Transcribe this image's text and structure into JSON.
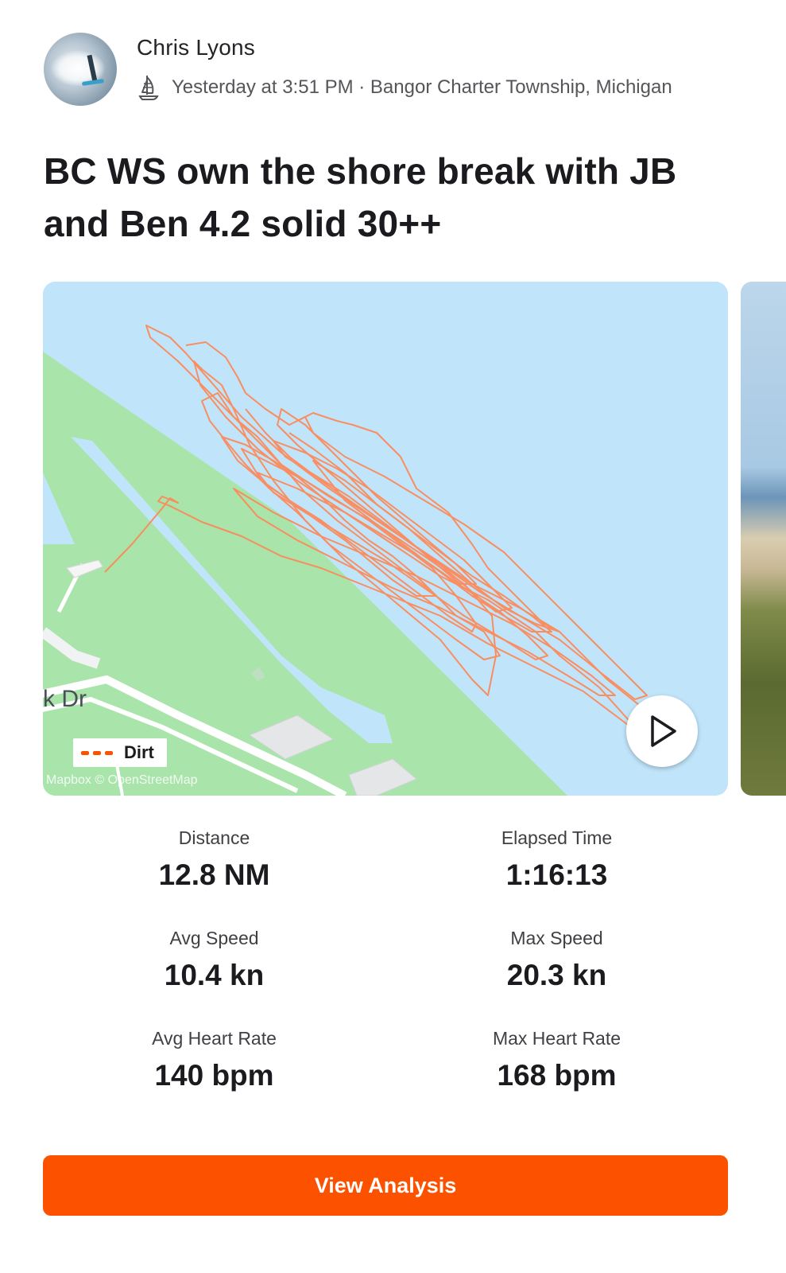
{
  "post": {
    "athlete_name": "Chris Lyons",
    "sport_icon": "windsurf-icon",
    "meta_text": "Yesterday at 3:51 PM · Bangor Charter Township, Michigan",
    "title": "BC WS own the shore break with JB and Ben 4.2 solid 30++"
  },
  "map": {
    "street_label": "rk Dr",
    "legend_label": "Dirt",
    "attribution": "Mapbox © OpenStreetMap",
    "play_icon": "play-icon",
    "route_color": "#fc5200",
    "water_color": "#c0e4f9",
    "land_color": "#a9e4ab"
  },
  "stats": [
    {
      "label": "Distance",
      "value": "12.8 NM"
    },
    {
      "label": "Elapsed Time",
      "value": "1:16:13"
    },
    {
      "label": "Avg Speed",
      "value": "10.4 kn"
    },
    {
      "label": "Max Speed",
      "value": "20.3 kn"
    },
    {
      "label": "Avg Heart Rate",
      "value": "140 bpm"
    },
    {
      "label": "Max Heart Rate",
      "value": "168 bpm"
    }
  ],
  "actions": {
    "view_analysis_label": "View Analysis"
  }
}
